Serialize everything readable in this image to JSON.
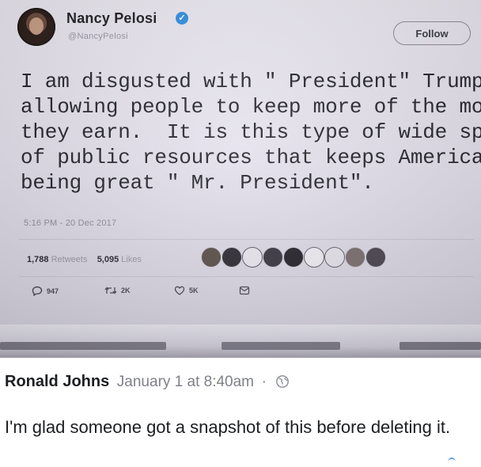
{
  "tweet": {
    "display_name": "Nancy Pelosi",
    "handle": "@NancyPelosi",
    "follow_label": "Follow",
    "text": "I am disgusted with \" President\" Trump\nallowing people to keep more of the money\nthey earn.  It is this type of wide spread theft\nof public resources that keeps America from\nbeing great \" Mr. President\".",
    "timestamp": "5:16 PM - 20 Dec 2017",
    "retweets_count": "1,788",
    "retweets_label": "Retweets",
    "likes_count": "5,095",
    "likes_label": "Likes",
    "actions": {
      "reply_count": "947",
      "retweet_count": "2K",
      "like_count": "5K"
    }
  },
  "comment": {
    "author": "Ronald Johns",
    "time": "January 1 at 8:40am",
    "separator": "·",
    "text": "I'm glad someone got a snapshot of this before deleting it."
  },
  "colors": {
    "verified": "#2f8fe0",
    "tweet_text": "#26252c",
    "comment_text": "#1c1e21",
    "muted": "#7f8187"
  }
}
